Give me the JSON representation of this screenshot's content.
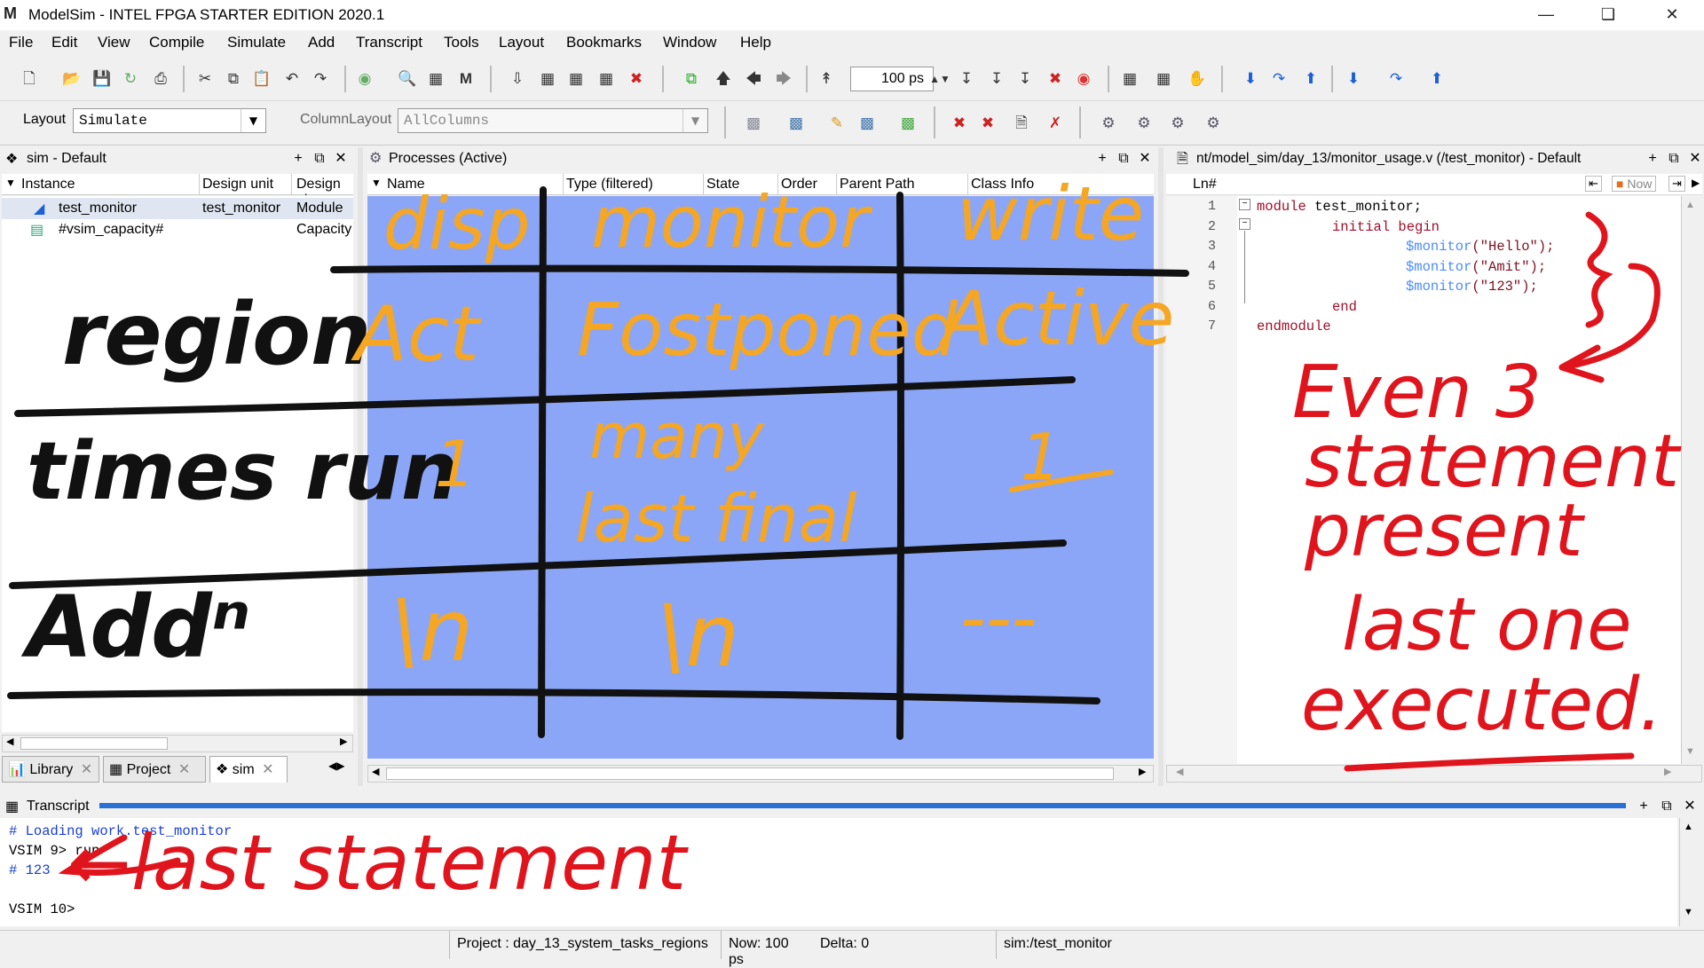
{
  "window": {
    "title": "ModelSim - INTEL FPGA STARTER EDITION 2020.1",
    "logo": "M",
    "controls": [
      "minimize-icon",
      "maximize-icon",
      "close-icon"
    ]
  },
  "menu": [
    "File",
    "Edit",
    "View",
    "Compile",
    "Simulate",
    "Add",
    "Transcript",
    "Tools",
    "Layout",
    "Bookmarks",
    "Window",
    "Help"
  ],
  "toolbar": {
    "time_value": "100 ps"
  },
  "layout_bar": {
    "layout_label": "Layout",
    "layout_value": "Simulate",
    "column_layout_label": "ColumnLayout",
    "column_layout_value": "AllColumns"
  },
  "sim_pane": {
    "title": "sim - Default",
    "columns": [
      "Instance",
      "Design unit",
      "Design ui"
    ],
    "rows": [
      {
        "instance": "test_monitor",
        "design_unit": "test_monitor",
        "type": "Module"
      },
      {
        "instance": "#vsim_capacity#",
        "design_unit": "",
        "type": "Capacity"
      }
    ],
    "tabs": [
      "Library",
      "Project",
      "sim"
    ]
  },
  "processes_pane": {
    "title": "Processes (Active)",
    "columns": [
      "Name",
      "Type (filtered)",
      "State",
      "Order",
      "Parent Path",
      "Class Info"
    ]
  },
  "source_pane": {
    "title": "nt/model_sim/day_13/monitor_usage.v (/test_monitor) - Default",
    "ln_label": "Ln#",
    "now_label": "Now",
    "line_numbers": [
      "1",
      "2",
      "3",
      "4",
      "5",
      "6",
      "7"
    ],
    "code": {
      "l1_kw": "module",
      "l1_rest": " test_monitor;",
      "l2_kw": "initial begin",
      "l3_sys": "$monitor",
      "l3_str": "(\"Hello\");",
      "l4_sys": "$monitor",
      "l4_str": "(\"Amit\");",
      "l5_sys": "$monitor",
      "l5_str": "(\"123\");",
      "l6_kw": "end",
      "l7_kw": "endmodule"
    }
  },
  "transcript": {
    "title": "Transcript",
    "lines": [
      "# Loading work.test_monitor",
      "VSIM 9> run",
      "# 123",
      "",
      "VSIM 10>"
    ]
  },
  "statusbar": {
    "project": "Project : day_13_system_tasks_regions",
    "now": "Now: 100 ps",
    "delta": "Delta: 0",
    "context": "sim:/test_monitor"
  },
  "annotations": {
    "table_headers": [
      "disp",
      "monitor",
      "write"
    ],
    "row_labels": [
      "region",
      "times run",
      "Addⁿ"
    ],
    "region_values": [
      "Act",
      "Fostponed",
      "Active"
    ],
    "times_values": [
      "1",
      "many",
      "last final",
      "1"
    ],
    "add_values": [
      "\\n",
      "\\n",
      "---"
    ],
    "side_note": [
      "Even 3",
      "statement",
      "present",
      "last one",
      "executed."
    ],
    "transcript_note": "←last statement"
  },
  "colors": {
    "process_bg": "#8ca6f7",
    "ink_orange": "#f5a623",
    "ink_red": "#e0141c",
    "ink_black": "#111111"
  }
}
